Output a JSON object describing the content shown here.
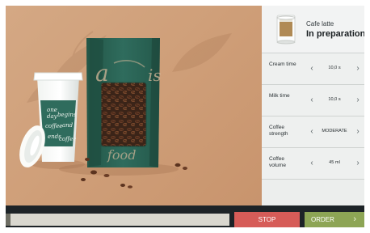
{
  "hero": {
    "cup_icon": "printed-paper-cup",
    "bag_icon": "coffee-bag",
    "cup_text": "one day begins coffee and ends with coffee",
    "bag_text_left": "a",
    "bag_text_right": "is",
    "bag_text_bottom": "food"
  },
  "current_order": {
    "name": "Cafe latte",
    "status": "In preparation",
    "cup_icon": "coffee-glass-icon"
  },
  "settings": [
    {
      "label": "Cream time",
      "value": "10,0 s"
    },
    {
      "label": "Milk time",
      "value": "10,0 s"
    },
    {
      "label": "Coffee\nstrength",
      "value": "MODERATE"
    },
    {
      "label": "Coffee\nvolume",
      "value": "45 ml"
    }
  ],
  "controls": {
    "left_arrow": "‹",
    "right_arrow": "›",
    "stop_label": "STOP",
    "order_label": "ORDER",
    "order_arrow": "›"
  },
  "progress": {
    "fraction": 0.02
  },
  "colors": {
    "hero_background": "#cf9f79",
    "panel_background": "#eceeed",
    "stop_button": "#d65c58",
    "order_button": "#8da555",
    "packaging_green": "#2f6c5d"
  }
}
